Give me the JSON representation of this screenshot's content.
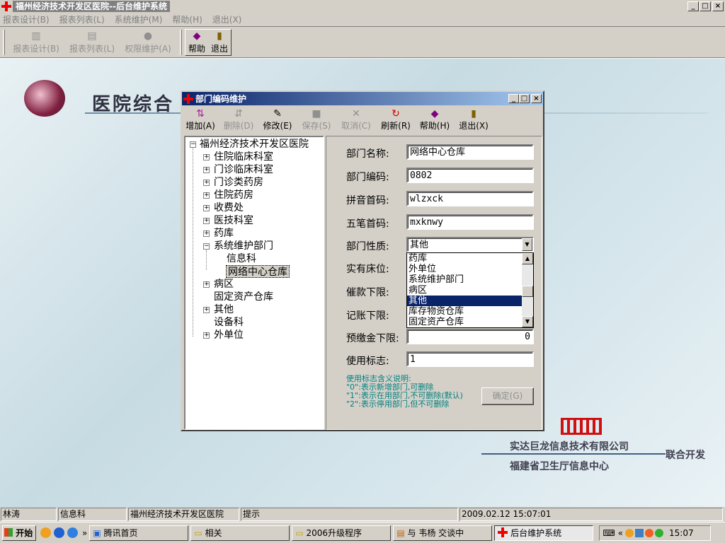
{
  "app": {
    "title": "福州经济技术开发区医院--后台维护系统",
    "window_controls": [
      "_",
      "□",
      "×"
    ]
  },
  "menu": [
    "报表设计(B)",
    "报表列表(L)",
    "系统维护(M)",
    "帮助(H)",
    "退出(X)"
  ],
  "toolbar": [
    {
      "label": "报表设计(B)",
      "icon": "report-design-icon",
      "glyph": "▥",
      "enabled": false
    },
    {
      "label": "报表列表(L)",
      "icon": "report-list-icon",
      "glyph": "▤",
      "enabled": false
    },
    {
      "label": "权限维护(A)",
      "icon": "permission-icon",
      "glyph": "●",
      "enabled": false
    },
    {
      "label": "帮助",
      "icon": "help-book-icon",
      "glyph": "◆",
      "enabled": true
    },
    {
      "label": "退出",
      "icon": "exit-door-icon",
      "glyph": "▮",
      "enabled": true
    }
  ],
  "desktop": {
    "banner": "医院综合",
    "company": "实达巨龙信息技术有限公司",
    "center": "福建省卫生厅信息中心",
    "joint": "联合开发"
  },
  "dialog": {
    "title": "部门编码维护",
    "toolbar": [
      {
        "label": "增加(A)",
        "icon": "add-icon",
        "glyph": "⇅",
        "enabled": true,
        "color": "#a020a0"
      },
      {
        "label": "删除(D)",
        "icon": "delete-icon",
        "glyph": "⇵",
        "enabled": false,
        "color": "#909090"
      },
      {
        "label": "修改(E)",
        "icon": "edit-icon",
        "glyph": "✎",
        "enabled": true,
        "color": "#000000"
      },
      {
        "label": "保存(S)",
        "icon": "save-icon",
        "glyph": "■",
        "enabled": false,
        "color": "#909090"
      },
      {
        "label": "取消(C)",
        "icon": "cancel-icon",
        "glyph": "✕",
        "enabled": false,
        "color": "#909090"
      },
      {
        "label": "刷新(R)",
        "icon": "refresh-icon",
        "glyph": "↻",
        "enabled": true,
        "color": "#cc0000"
      },
      {
        "label": "帮助(H)",
        "icon": "help-book-icon",
        "glyph": "◆",
        "enabled": true,
        "color": "#800080"
      },
      {
        "label": "退出(X)",
        "icon": "exit-door-icon",
        "glyph": "▮",
        "enabled": true,
        "color": "#806000"
      }
    ],
    "tree": {
      "root": "福州经济技术开发区医院",
      "items": [
        {
          "label": "住院临床科室",
          "expandable": true
        },
        {
          "label": "门诊临床科室",
          "expandable": true
        },
        {
          "label": "门诊类药房",
          "expandable": true
        },
        {
          "label": "住院药房",
          "expandable": true
        },
        {
          "label": "收费处",
          "expandable": true
        },
        {
          "label": "医技科室",
          "expandable": true
        },
        {
          "label": "药库",
          "expandable": true
        },
        {
          "label": "系统维护部门",
          "expandable": true,
          "expanded": true
        },
        {
          "label": "信息科",
          "child": true
        },
        {
          "label": "网络中心仓库",
          "child": true,
          "selected": true
        },
        {
          "label": "病区",
          "expandable": true
        },
        {
          "label": "固定资产仓库",
          "expandable": false
        },
        {
          "label": "其他",
          "expandable": true
        },
        {
          "label": "设备科",
          "expandable": false
        },
        {
          "label": "外单位",
          "expandable": true
        }
      ]
    },
    "form": {
      "name_label": "部门名称:",
      "name_value": "网络中心仓库",
      "code_label": "部门编码:",
      "code_value": "0802",
      "pinyin_label": "拼音首码:",
      "pinyin_value": "wlzxck",
      "wubi_label": "五笔首码:",
      "wubi_value": "mxknwy",
      "type_label": "部门性质:",
      "type_value": "其他",
      "beds_label": "实有床位:",
      "dunning_label": "催款下限:",
      "credit_label": "记账下限:",
      "deposit_label": "预缴金下限:",
      "deposit_value": "0",
      "flag_label": "使用标志:",
      "flag_value": "1",
      "type_options": [
        "药库",
        "外单位",
        "系统维护部门",
        "病区",
        "其他",
        "库存物资仓库",
        "固定资产仓库"
      ],
      "type_selected_index": 4
    },
    "help_text": {
      "title": "使用标志含义说明:",
      "line0": "\"0\":表示新增部门,可删除",
      "line1": "\"1\":表示在用部门,不可删除(默认)",
      "line2": "\"2\":表示停用部门,但不可删除"
    },
    "confirm_label": "确定(G)"
  },
  "status": {
    "user": "林涛",
    "dept": "信息科",
    "hospital": "福州经济技术开发区医院",
    "hint": "提示",
    "datetime": "2009.02.12 15:07:01"
  },
  "taskbar": {
    "start": "开始",
    "chevron": "»",
    "tasks": [
      "腾讯首页",
      "相关",
      "2006升级程序",
      "与 韦杨 交谈中",
      "后台维护系统"
    ],
    "tray_chevron": "«",
    "clock": "15:07"
  }
}
